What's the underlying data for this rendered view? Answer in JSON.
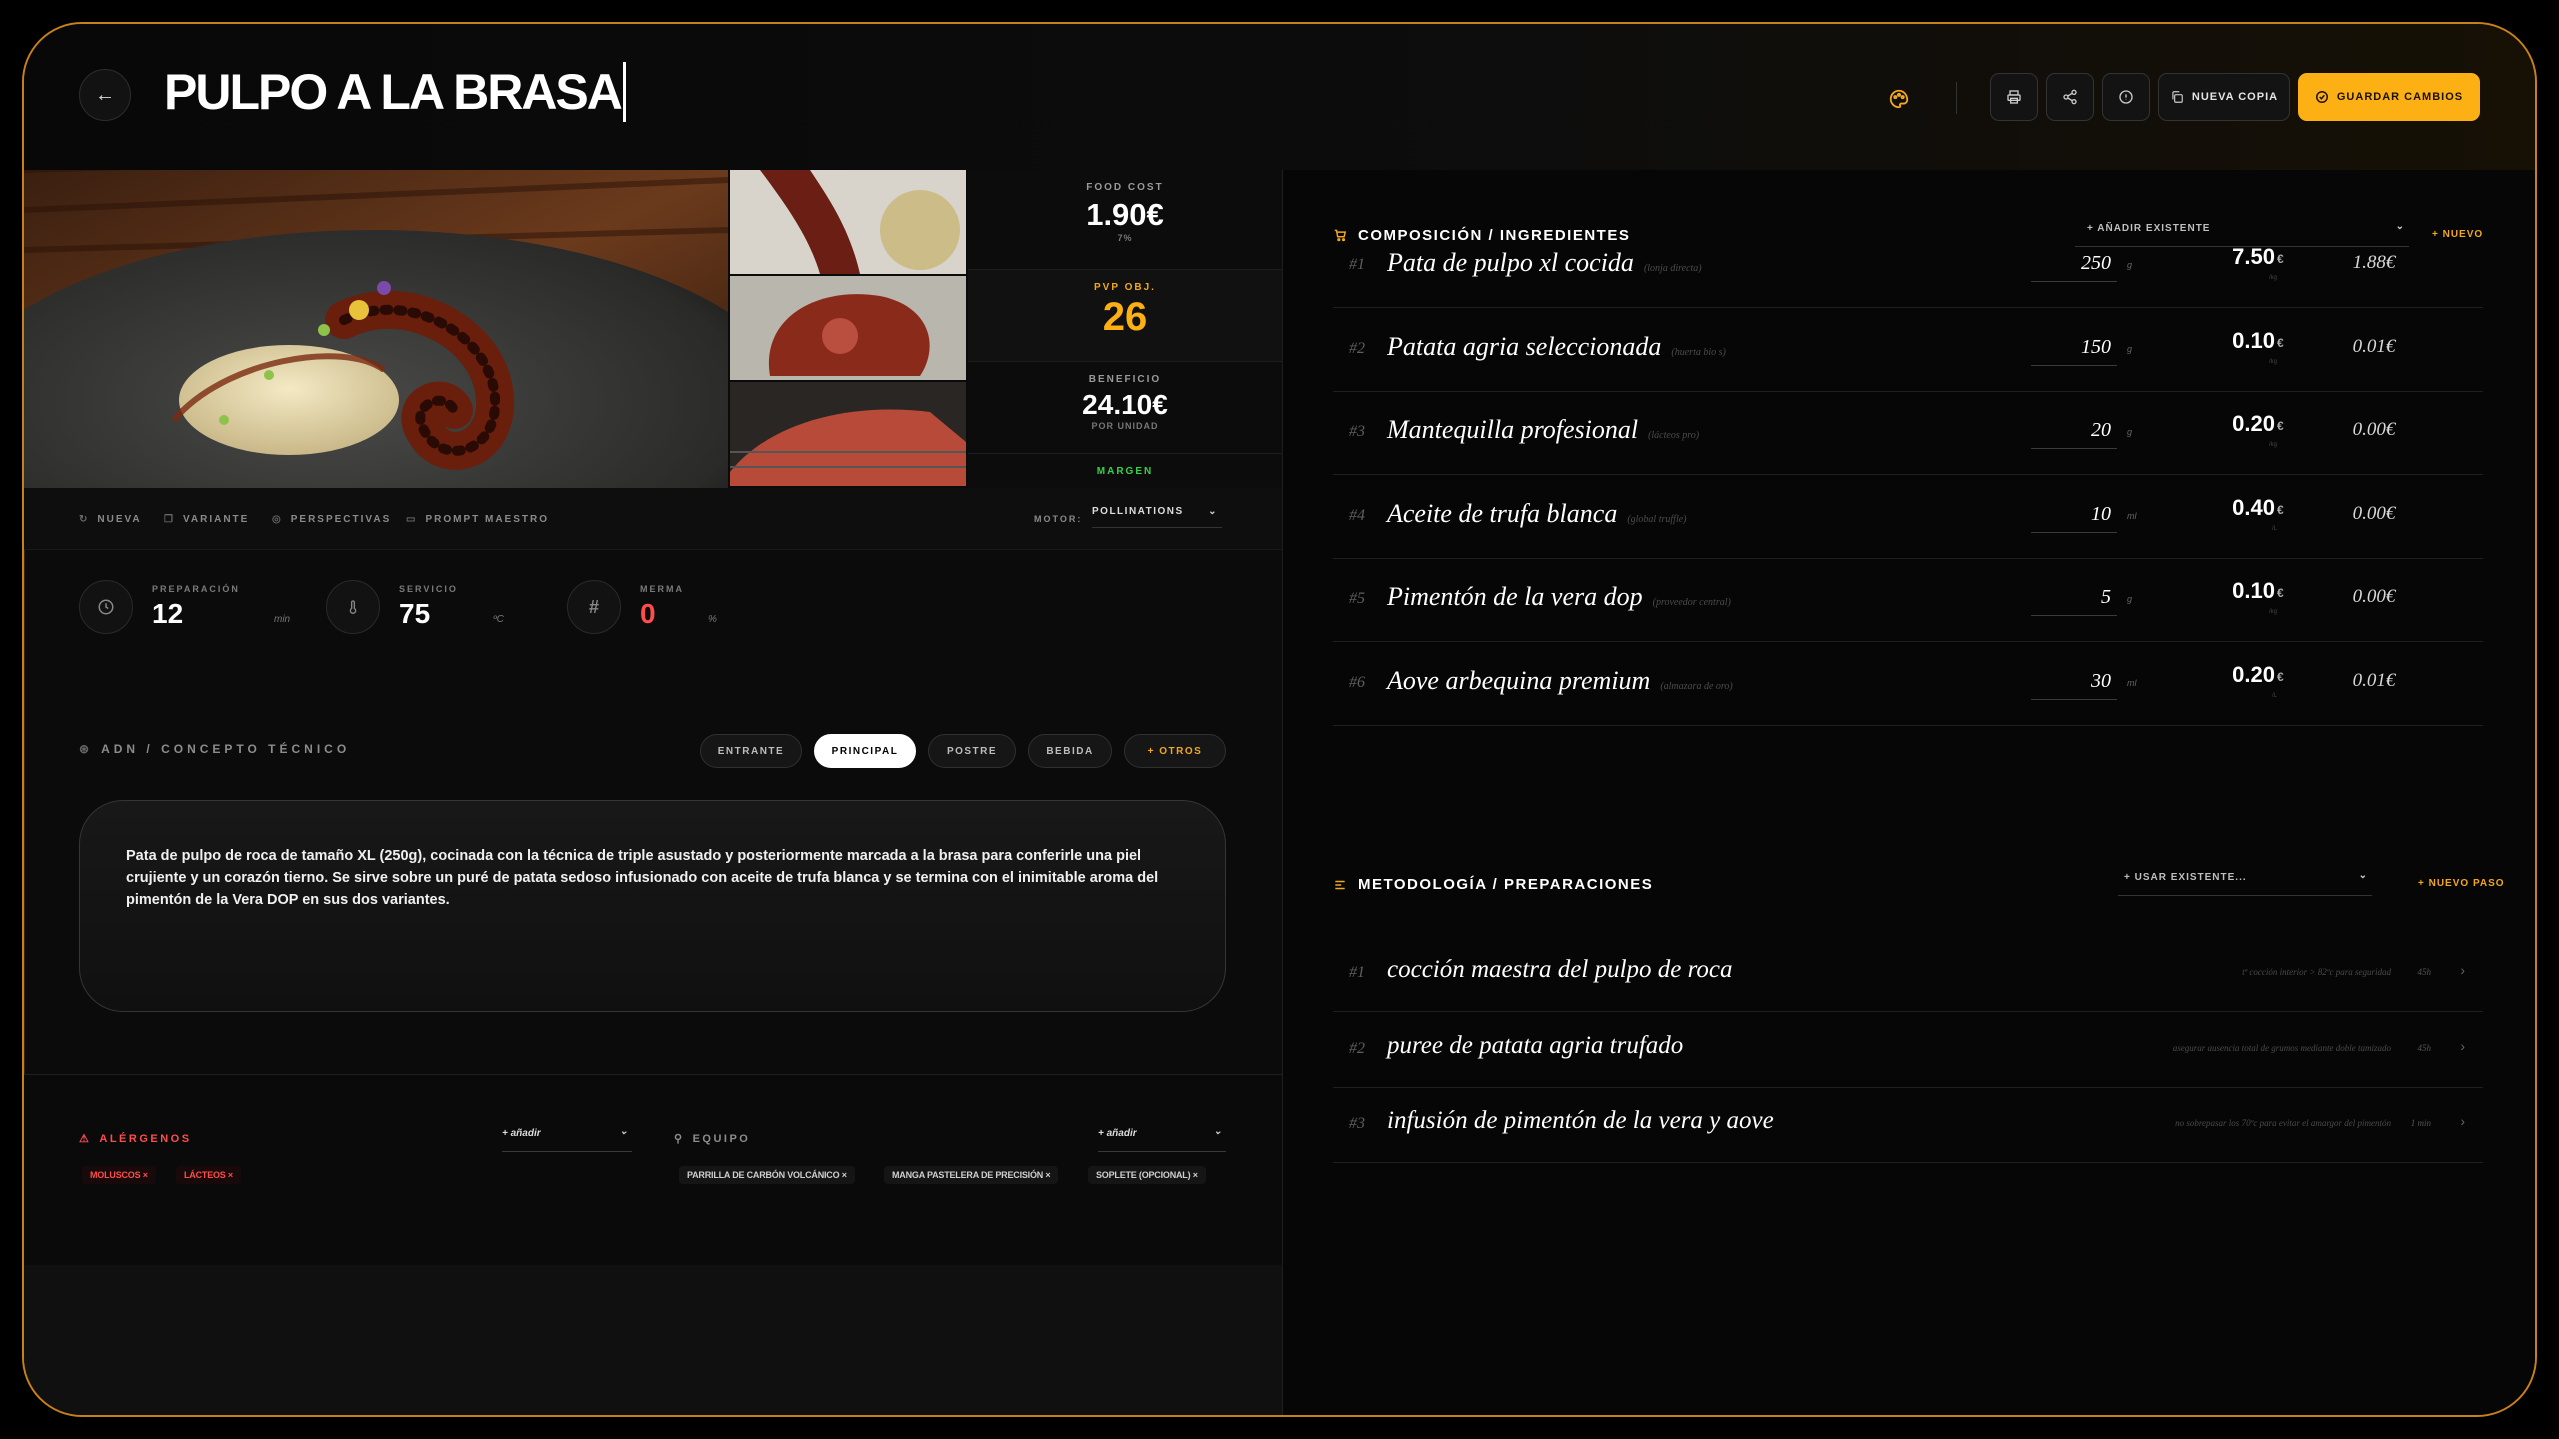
{
  "header": {
    "title": "PULPO A LA BRASA",
    "actions": {
      "new_copy": "NUEVA COPIA",
      "save": "GUARDAR CAMBIOS"
    }
  },
  "metrics": {
    "food_cost_label": "FOOD COST",
    "food_cost_value": "1.90€",
    "food_cost_sub": "7%",
    "pvp_label": "PVP OBJ.",
    "pvp_value": "26",
    "profit_label": "BENEFICIO",
    "profit_value": "24.10€",
    "profit_sub": "POR UNIDAD",
    "margin_label": "MARGEN"
  },
  "image_tools": {
    "new": "NUEVA",
    "variant": "VARIANTE",
    "perspectives": "PERSPECTIVAS",
    "master_prompt": "PROMPT MAESTRO",
    "engine_label": "MOTOR:",
    "engine_value": "POLLINATIONS"
  },
  "stats": {
    "prep_label": "PREPARACIÓN",
    "prep_value": "12",
    "prep_unit": "min",
    "service_label": "SERVICIO",
    "service_value": "75",
    "service_unit": "ºC",
    "waste_label": "MERMA",
    "waste_value": "0",
    "waste_unit": "%"
  },
  "concept": {
    "title": "ADN / CONCEPTO TÉCNICO",
    "categories": [
      "ENTRANTE",
      "PRINCIPAL",
      "POSTRE",
      "BEBIDA",
      "+ OTROS"
    ],
    "active_category": "PRINCIPAL",
    "description": "Pata de pulpo de roca de tamaño XL (250g), cocinada con la técnica de triple asustado y posteriormente marcada a la brasa para conferirle una piel crujiente y un corazón tierno. Se sirve sobre un puré de patata sedoso infusionado con aceite de trufa blanca y se termina con el inimitable aroma del pimentón de la Vera DOP en sus dos variantes."
  },
  "allergens": {
    "title": "ALÉRGENOS",
    "select": "+ añadir",
    "items": [
      "MOLUSCOS ×",
      "LÁCTEOS ×"
    ]
  },
  "equipment": {
    "title": "EQUIPO",
    "select": "+ añadir",
    "items": [
      "PARRILLA DE CARBÓN VOLCÁNICO ×",
      "MANGA PASTELERA DE PRECISIÓN ×",
      "SOPLETE (OPCIONAL) ×"
    ]
  },
  "ingredients": {
    "title": "COMPOSICIÓN / INGREDIENTES",
    "select": "+ AÑADIR EXISTENTE",
    "new_link": "+ NUEVO",
    "rows": [
      {
        "num": "#1",
        "name": "Pata de pulpo xl cocida",
        "note": "(lonja directa)",
        "qty": "250",
        "unit": "g",
        "price": "7.50",
        "cur": "€",
        "price_sub": "/kg",
        "total": "1.88€"
      },
      {
        "num": "#2",
        "name": "Patata agria seleccionada",
        "note": "(huerta bio s)",
        "qty": "150",
        "unit": "g",
        "price": "0.10",
        "cur": "€",
        "price_sub": "/kg",
        "total": "0.01€"
      },
      {
        "num": "#3",
        "name": "Mantequilla profesional",
        "note": "(lácteos pro)",
        "qty": "20",
        "unit": "g",
        "price": "0.20",
        "cur": "€",
        "price_sub": "/kg",
        "total": "0.00€"
      },
      {
        "num": "#4",
        "name": "Aceite de trufa blanca",
        "note": "(global truffle)",
        "qty": "10",
        "unit": "ml",
        "price": "0.40",
        "cur": "€",
        "price_sub": "/L",
        "total": "0.00€"
      },
      {
        "num": "#5",
        "name": "Pimentón de la vera dop",
        "note": "(proveedor central)",
        "qty": "5",
        "unit": "g",
        "price": "0.10",
        "cur": "€",
        "price_sub": "/kg",
        "total": "0.00€"
      },
      {
        "num": "#6",
        "name": "Aove arbequina premium",
        "note": "(almazara de oro)",
        "qty": "30",
        "unit": "ml",
        "price": "0.20",
        "cur": "€",
        "price_sub": "/L",
        "total": "0.01€"
      }
    ]
  },
  "methodology": {
    "title": "METODOLOGÍA / PREPARACIONES",
    "select": "+ USAR EXISTENTE...",
    "new_link": "+ NUEVO PASO",
    "steps": [
      {
        "num": "#1",
        "name": "cocción maestra del pulpo de roca",
        "hint": "tª cocción interior > 82ºc para seguridad",
        "time": "45h"
      },
      {
        "num": "#2",
        "name": "puree de patata agria trufado",
        "hint": "asegurar ausencia total de grumos mediante doble tamizado",
        "time": "45h"
      },
      {
        "num": "#3",
        "name": "infusión de pimentón de la vera y aove",
        "hint": "no sobrepasar los 70ºc para evitar el amargor del pimentón",
        "time": "1 min"
      }
    ]
  },
  "colors": {
    "accent": "#fdb014",
    "allergen": "#ff4d4d",
    "margin": "#35d34a",
    "frame": "#c8801a"
  }
}
